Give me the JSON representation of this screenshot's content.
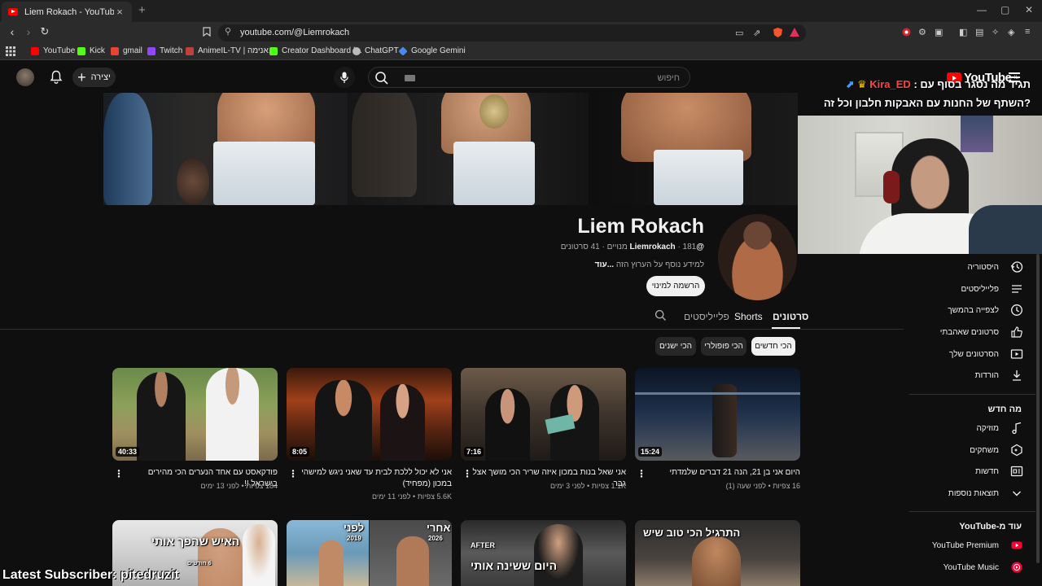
{
  "browser": {
    "tab_title": "Liem Rokach - YouTube",
    "url": "youtube.com/@Liemrokach",
    "bookmarks": [
      {
        "label": "YouTube",
        "color": "#ff0000"
      },
      {
        "label": "Kick",
        "color": "#53fc18"
      },
      {
        "label": "gmail",
        "color": "#ea4335"
      },
      {
        "label": "Twitch",
        "color": "#9146ff"
      },
      {
        "label": "AnimeIL-TV | אנימה...",
        "color": "#c04040"
      },
      {
        "label": "Creator Dashboard |...",
        "color": "#53fc18"
      },
      {
        "label": "ChatGPT",
        "color": "#bbbbbb"
      },
      {
        "label": "Google Gemini",
        "color": "#4a8af4"
      }
    ]
  },
  "masthead": {
    "create_label": "יצירה",
    "search_placeholder": "חיפוש",
    "logo_text": "YouTube",
    "logo_region": "IL"
  },
  "channel": {
    "name": "Liem Rokach",
    "handle": "@Liemrokach",
    "subscribers": "181 מנויים",
    "video_count": "41 סרטונים",
    "description": "למידע נוסף על הערוץ הזה",
    "more_label": "...עוד",
    "subscribe_label": "הרשמה למינוי"
  },
  "tabs": [
    {
      "label": "סרטונים",
      "active": true
    },
    {
      "label": "Shorts",
      "active": false
    },
    {
      "label": "פלייליסטים",
      "active": false
    }
  ],
  "chips": [
    {
      "label": "הכי חדשים",
      "selected": true
    },
    {
      "label": "הכי פופולרי",
      "selected": false
    },
    {
      "label": "הכי ישנים",
      "selected": false
    }
  ],
  "videos": [
    {
      "title": "היום אני בן 21, הנה 21 דברים שלמדתי",
      "meta": "16 צפיות • לפני שעה (1)",
      "duration": "15:24"
    },
    {
      "title": "אני שאל בנות במכון איזה שריר הכי מושך אצל גבר",
      "meta": "1.1K צפיות • לפני 3 ימים",
      "duration": "7:16"
    },
    {
      "title": "אני לא יכול ללכת לבית עד שאני ניגש למישהי במכון (מפחיד)",
      "meta": "5.6K צפיות • לפני 11 ימים",
      "duration": "8:05"
    },
    {
      "title": "פודקאסט עם אחד הנערים הכי מהירים בישראל !!",
      "meta": "184 צפיות • לפני 13 ימים",
      "duration": "40:33"
    }
  ],
  "thumb_overlays": {
    "row2_1": "התרגיל הכי טוב שיש",
    "row2_2a": "AFTER",
    "row2_2b": "היום ששינה אותי",
    "row2_3a": "אחרי",
    "row2_3b": "2026",
    "row2_3c": "לפני",
    "row2_3d": "2019",
    "row2_4": "האיש שהפך אותי",
    "row2_4b": "6 חודשים"
  },
  "sidebar": {
    "items": [
      {
        "label": "היסטוריה",
        "icon": "history-icon"
      },
      {
        "label": "פלייליסטים",
        "icon": "playlist-icon"
      },
      {
        "label": "לצפייה בהמשך",
        "icon": "clock-icon"
      },
      {
        "label": "סרטונים שאהבתי",
        "icon": "like-icon"
      },
      {
        "label": "הסרטונים שלך",
        "icon": "your-videos-icon"
      },
      {
        "label": "הורדות",
        "icon": "download-icon"
      }
    ],
    "whats_new_heading": "מה חדש",
    "whats_new": [
      {
        "label": "מוזיקה",
        "icon": "music-icon"
      },
      {
        "label": "משחקים",
        "icon": "gaming-icon"
      },
      {
        "label": "חדשות",
        "icon": "news-icon"
      },
      {
        "label": "תוצאות נוספות",
        "icon": "chevron-down-icon"
      }
    ],
    "more_heading": "עוד מ-YouTube",
    "more": [
      {
        "label": "YouTube Premium",
        "color": "#ff0033"
      },
      {
        "label": "YouTube Music",
        "color": "#ff0033"
      }
    ]
  },
  "overlay": {
    "alert_prefix": "תגיד מה נסגר בסוף עם :",
    "alert_name": "Kira_ED",
    "alert_line2": "?השתף של החנות עם האבקות חלבון וכל זה",
    "latest_subscriber": "Latest Subscriber: pitedruzit"
  }
}
